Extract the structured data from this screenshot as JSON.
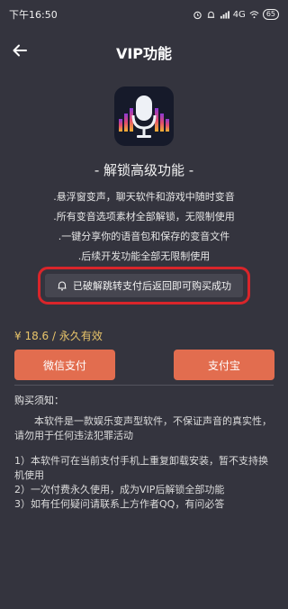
{
  "status_bar": {
    "time": "下午16:50",
    "network": "4G",
    "battery": "65"
  },
  "header": {
    "title": "VIP功能"
  },
  "icons": {
    "back": "arrow-left-icon",
    "alarm": "alarm-icon",
    "notification": "bell-icon",
    "logo": "microphone-equalizer-logo",
    "notice": "bell-icon"
  },
  "headline": "- 解锁高级功能 -",
  "features": [
    ".悬浮窗变声，聊天软件和游戏中随时变音",
    ".所有变音选项素材全部解锁，无限制使用",
    ".一键分享你的语音包和保存的变音文件",
    ".后续开发功能全部无限制使用"
  ],
  "notice": "已破解跳转支付后返回即可购买成功",
  "price": "¥ 18.6 / 永久有效",
  "payment": {
    "wechat": "微信支付",
    "alipay": "支付宝"
  },
  "notes_title": "购买须知：",
  "notes": {
    "p1": "本软件是一款娱乐变声型软件，不保证声音的真实性，请勿用于任何违法犯罪活动",
    "p2_intro": "1）本软件可在当前支付手机上重复卸载安装，暂不支持换机使用",
    "p2_item2": "2）一次付费永久使用，成为VIP后解锁全部功能",
    "p2_item3": "3）如有任何疑问请联系上方作者QQ，有问必答"
  },
  "colors": {
    "background": "#34343e",
    "accent": "#e26d4f",
    "price": "#e8c46a",
    "highlight_border": "#d9252a"
  }
}
